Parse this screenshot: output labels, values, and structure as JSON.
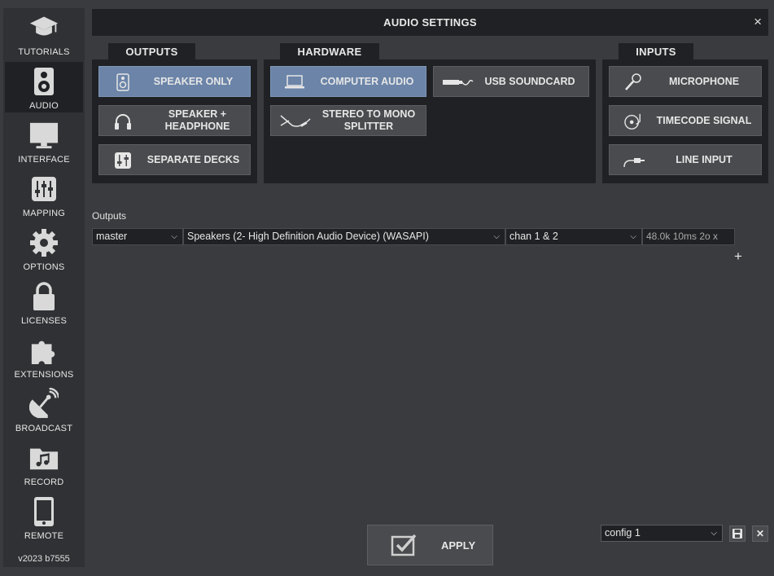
{
  "window": {
    "title": "AUDIO SETTINGS",
    "close": "×"
  },
  "sidebar": {
    "items": [
      {
        "label": "TUTORIALS",
        "icon": "graduation-cap-icon"
      },
      {
        "label": "AUDIO",
        "icon": "speaker-icon",
        "active": true
      },
      {
        "label": "INTERFACE",
        "icon": "monitor-icon"
      },
      {
        "label": "MAPPING",
        "icon": "sliders-icon"
      },
      {
        "label": "OPTIONS",
        "icon": "gear-icon"
      },
      {
        "label": "LICENSES",
        "icon": "lock-icon"
      },
      {
        "label": "EXTENSIONS",
        "icon": "puzzle-icon"
      },
      {
        "label": "BROADCAST",
        "icon": "satellite-dish-icon"
      },
      {
        "label": "RECORD",
        "icon": "music-folder-icon"
      },
      {
        "label": "REMOTE",
        "icon": "phone-icon"
      }
    ],
    "version": "v2023 b7555"
  },
  "outputs": {
    "tab": "OUTPUTS",
    "buttons": [
      {
        "label": "SPEAKER ONLY",
        "selected": true
      },
      {
        "label": "SPEAKER + HEADPHONE"
      },
      {
        "label": "SEPARATE DECKS"
      }
    ]
  },
  "hardware": {
    "tab": "HARDWARE",
    "buttons": [
      {
        "label": "COMPUTER AUDIO",
        "selected": true
      },
      {
        "label": "USB SOUNDCARD"
      },
      {
        "label": "STEREO TO MONO SPLITTER"
      }
    ]
  },
  "inputs": {
    "tab": "INPUTS",
    "buttons": [
      {
        "label": "MICROPHONE"
      },
      {
        "label": "TIMECODE SIGNAL"
      },
      {
        "label": "LINE INPUT"
      }
    ]
  },
  "output_config": {
    "label": "Outputs",
    "channel": "master",
    "device": "Speakers (2- High Definition Audio Device) (WASAPI)",
    "channels": "chan 1 & 2",
    "info": "48.0k 10ms 2o x",
    "add": "+"
  },
  "footer": {
    "apply": "APPLY",
    "config": "config 1",
    "delete": "✕"
  },
  "colors": {
    "selected": "#6b84a8",
    "panel": "#202124",
    "button": "#4a4b4e"
  }
}
